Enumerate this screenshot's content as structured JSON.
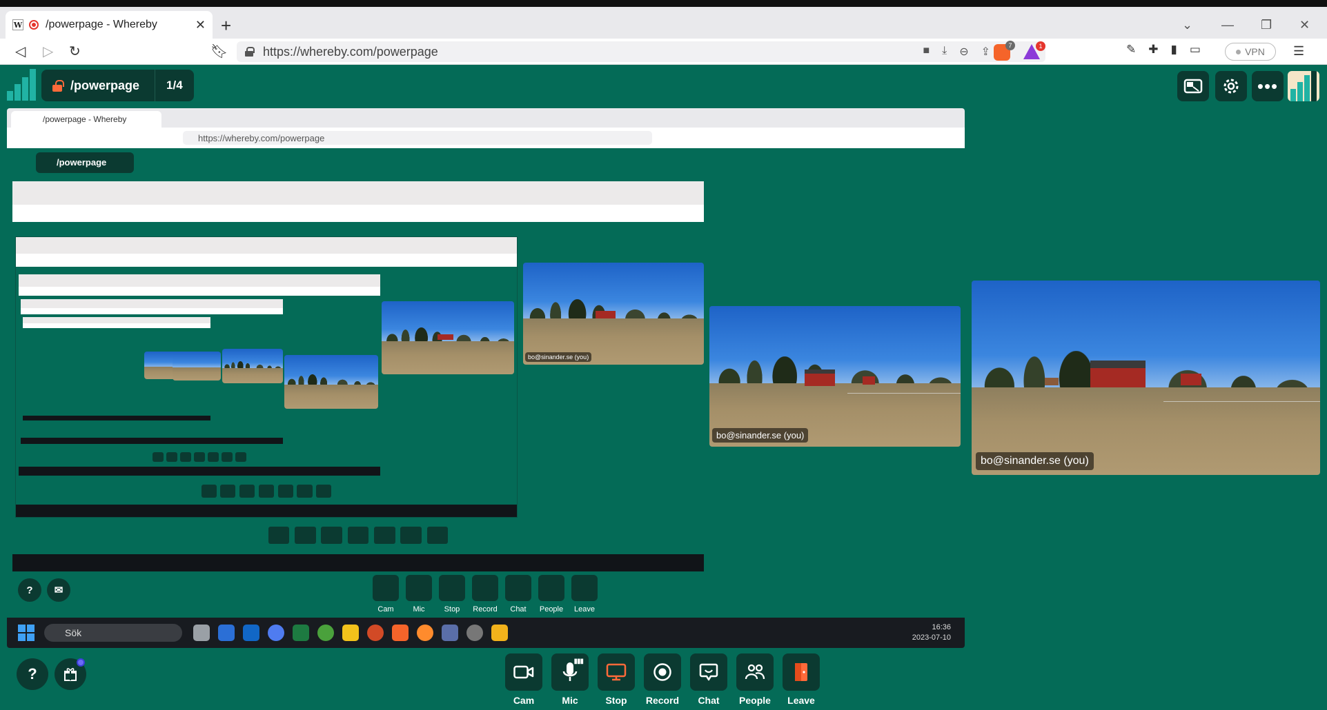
{
  "browser": {
    "tab_title": "/powerpage - Whereby",
    "url": "https://whereby.com/powerpage",
    "brave_badge": "7",
    "bat_badge": "1",
    "vpn_label": "VPN"
  },
  "room": {
    "name": "/powerpage",
    "participant_count": "1/4"
  },
  "participants": {
    "self_label": "bo@sinander.se (you)"
  },
  "controls": [
    {
      "label": "Cam",
      "icon": "camera-icon"
    },
    {
      "label": "Mic",
      "icon": "microphone-icon"
    },
    {
      "label": "Stop",
      "icon": "screen-share-icon"
    },
    {
      "label": "Record",
      "icon": "record-icon"
    },
    {
      "label": "Chat",
      "icon": "chat-icon"
    },
    {
      "label": "People",
      "icon": "people-icon"
    },
    {
      "label": "Leave",
      "icon": "leave-door-icon"
    }
  ],
  "help": {
    "label": "?"
  },
  "taskbar": {
    "search": "Sök",
    "time": "16:36",
    "date": "2023-07-10"
  },
  "colors": {
    "background": "#046b57",
    "control_bg": "#0b3a31",
    "accent_orange": "#ff6a3a",
    "logo_teal": "#21b3a4"
  }
}
